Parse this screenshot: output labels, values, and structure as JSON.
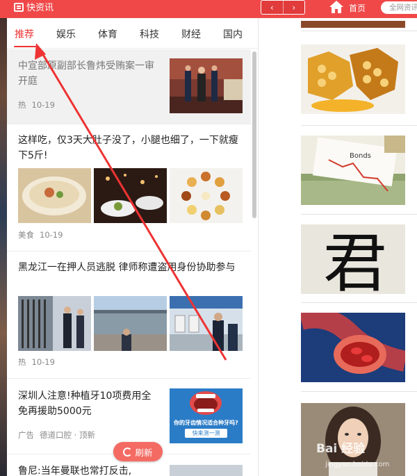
{
  "app": {
    "title": "快资讯"
  },
  "topbar": {
    "back_glyph": "‹",
    "forward_glyph": "›",
    "home_label": "首页",
    "search_placeholder": "全网资讯"
  },
  "tabs": [
    {
      "label": "推荐",
      "active": true
    },
    {
      "label": "娱乐"
    },
    {
      "label": "体育"
    },
    {
      "label": "科技"
    },
    {
      "label": "财经"
    },
    {
      "label": "国内"
    }
  ],
  "feed": [
    {
      "title": "中宣部原副部长鲁炜受贿案一审开庭",
      "tag": "热",
      "date": "10-19"
    },
    {
      "title": "这样吃，仅3天大肚子没了，小腿也细了，一下就瘦下5斤!",
      "tag": "美食",
      "date": "10-19"
    },
    {
      "title": "黑龙江一在押人员逃脱 律师称遭盗用身份协助参与",
      "tag": "热",
      "date": "10-19"
    },
    {
      "title": "深圳人注意!种植牙10项费用全免再援助5000元",
      "tag": "广告",
      "source": "德道口腔 · 顶新",
      "ad_line1": "你的牙齿情况适合种牙吗?",
      "ad_line2": "快来测一测"
    },
    {
      "title": "鲁尼:当年曼联也常打反击,"
    }
  ],
  "refresh_label": "刷新",
  "right_column": {
    "bonds_text": "Bonds",
    "calligraphy_char": "君"
  },
  "watermark": {
    "main": "Bai 经验",
    "sub": "jingyan.baidu.com"
  },
  "colors": {
    "brand": "#f04848",
    "active_tab": "#e33333",
    "refresh": "#f46b64"
  },
  "icons": [
    "app-logo-icon",
    "back-arrow-icon",
    "forward-arrow-icon",
    "home-icon",
    "refresh-icon"
  ]
}
